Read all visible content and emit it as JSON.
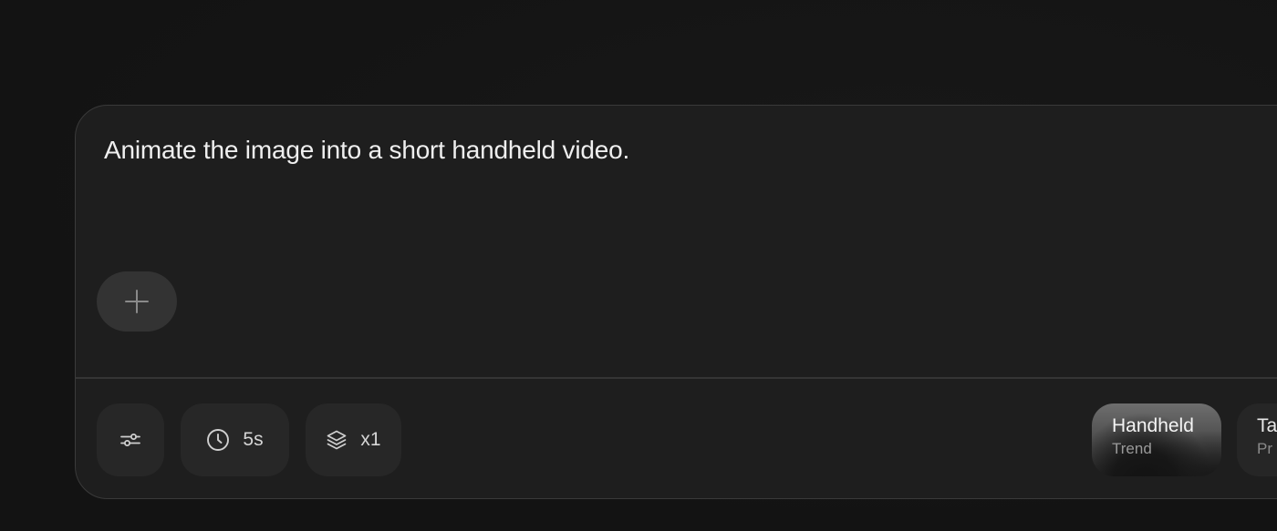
{
  "composer": {
    "prompt_text": "Animate the image into a short handheld video."
  },
  "toolbar": {
    "duration_label": "5s",
    "count_label": "x1"
  },
  "presets": [
    {
      "title": "Handheld",
      "subtitle": "Trend"
    },
    {
      "title": "Ta",
      "subtitle": "Pr"
    }
  ],
  "icons": {
    "add": "plus-icon",
    "settings": "sliders-icon",
    "duration": "clock-icon",
    "count": "layers-icon"
  },
  "colors": {
    "background": "#141414",
    "panel": "#1e1e1e",
    "chip": "#272727",
    "border": "#3a3a3a"
  }
}
